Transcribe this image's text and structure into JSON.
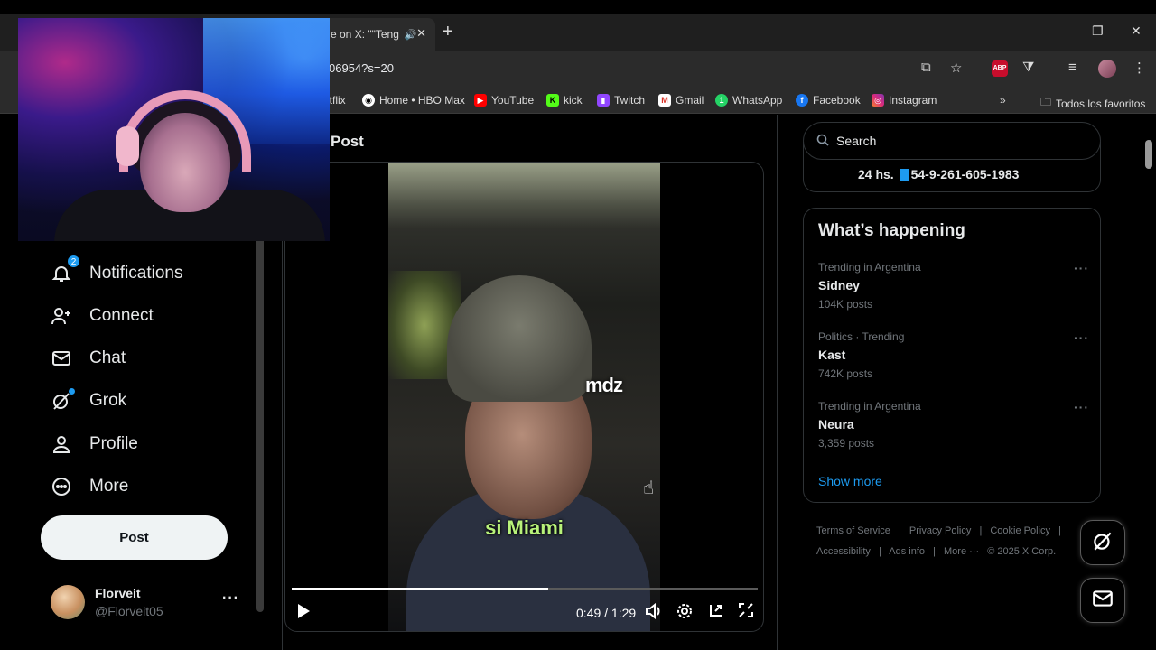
{
  "browser": {
    "tab_title": "e on X: \"\"Teng",
    "new_tab": "+",
    "url": "06954?s=20",
    "bookmarks": [
      {
        "label": "etflix",
        "icon": "netflix-icon"
      },
      {
        "label": "Home • HBO Max",
        "icon": "hbo-icon"
      },
      {
        "label": "YouTube",
        "icon": "youtube-icon"
      },
      {
        "label": "kick",
        "icon": "kick-icon"
      },
      {
        "label": "Twitch",
        "icon": "twitch-icon"
      },
      {
        "label": "Gmail",
        "icon": "gmail-icon"
      },
      {
        "label": "WhatsApp",
        "icon": "whatsapp-icon"
      },
      {
        "label": "Facebook",
        "icon": "facebook-icon"
      },
      {
        "label": "Instagram",
        "icon": "instagram-icon"
      }
    ],
    "all_bookmarks": "Todos los favoritos",
    "abp_label": "ABP"
  },
  "nav": {
    "items": [
      {
        "label": "Notifications",
        "badge": "2"
      },
      {
        "label": "Connect"
      },
      {
        "label": "Chat"
      },
      {
        "label": "Grok"
      },
      {
        "label": "Profile"
      },
      {
        "label": "More"
      }
    ],
    "post_label": "Post",
    "user": {
      "name": "Florveit",
      "handle": "@Florveit05"
    }
  },
  "main": {
    "title": "Post",
    "video": {
      "watermark": "mdz",
      "caption": "si Miami",
      "time": "0:49 / 1:29",
      "progress": 0.55
    }
  },
  "sidebar": {
    "search_placeholder": "Search",
    "phone_prefix": "24 hs.",
    "phone_number": "54-9-261-605-1983",
    "happening_title": "What’s happening",
    "trends": [
      {
        "context": "Trending in Argentina",
        "name": "Sidney",
        "count": "104K posts"
      },
      {
        "context": "Politics · Trending",
        "name": "Kast",
        "count": "742K posts"
      },
      {
        "context": "Trending in Argentina",
        "name": "Neura",
        "count": "3,359 posts"
      }
    ],
    "show_more": "Show more",
    "footer_links": [
      "Terms of Service",
      "|",
      "Privacy Policy",
      "|",
      "Cookie Policy",
      "|",
      "Accessibility",
      "|",
      "Ads info",
      "|",
      "More ···",
      "© 2025 X Corp."
    ]
  },
  "colors": {
    "accent": "#1d9bf0",
    "background": "#000000",
    "caption": "#b8f27a"
  }
}
